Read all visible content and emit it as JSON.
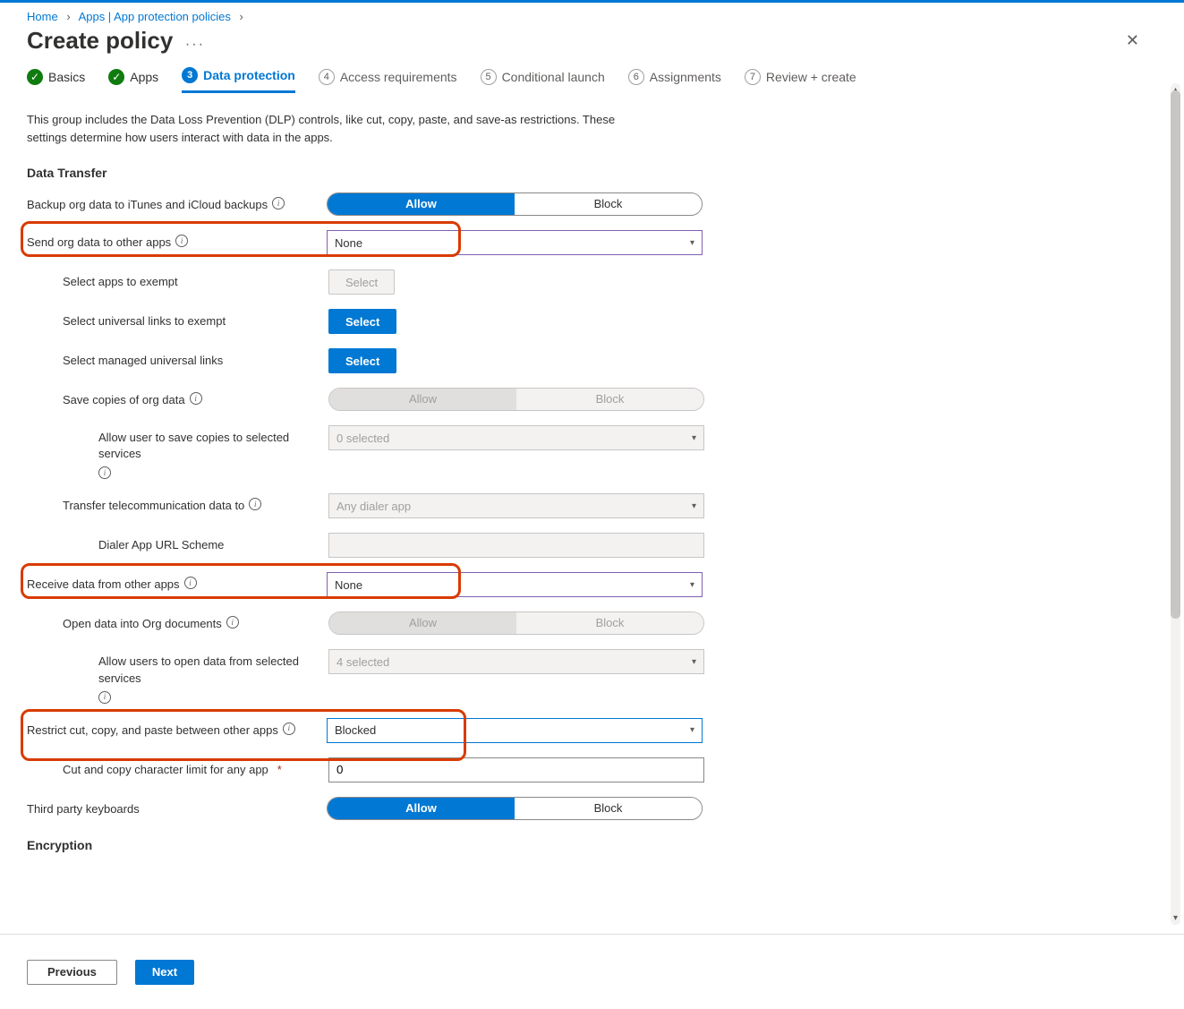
{
  "breadcrumb": {
    "home": "Home",
    "apps": "Apps | App protection policies"
  },
  "title": "Create policy",
  "steps": [
    {
      "num": "1",
      "label": "Basics",
      "state": "done"
    },
    {
      "num": "2",
      "label": "Apps",
      "state": "done"
    },
    {
      "num": "3",
      "label": "Data protection",
      "state": "current"
    },
    {
      "num": "4",
      "label": "Access requirements",
      "state": "future"
    },
    {
      "num": "5",
      "label": "Conditional launch",
      "state": "future"
    },
    {
      "num": "6",
      "label": "Assignments",
      "state": "future"
    },
    {
      "num": "7",
      "label": "Review + create",
      "state": "future"
    }
  ],
  "description": "This group includes the Data Loss Prevention (DLP) controls, like cut, copy, paste, and save-as restrictions. These settings determine how users interact with data in the apps.",
  "section_data_transfer": "Data Transfer",
  "section_encryption": "Encryption",
  "labels": {
    "backup": "Backup org data to iTunes and iCloud backups",
    "send": "Send org data to other apps",
    "exempt_apps": "Select apps to exempt",
    "exempt_links": "Select universal links to exempt",
    "managed_links": "Select managed universal links",
    "save_copies": "Save copies of org data",
    "save_services": "Allow user to save copies to selected services",
    "telecom": "Transfer telecommunication data to",
    "dialer": "Dialer App URL Scheme",
    "receive": "Receive data from other apps",
    "open_data": "Open data into Org documents",
    "open_services": "Allow users to open data from selected services",
    "restrict": "Restrict cut, copy, and paste between other apps",
    "char_limit": "Cut and copy character limit for any app",
    "keyboards": "Third party keyboards"
  },
  "values": {
    "send": "None",
    "save_services": "0 selected",
    "telecom": "Any dialer app",
    "receive": "None",
    "open_services": "4 selected",
    "restrict": "Blocked",
    "char_limit": "0"
  },
  "buttons": {
    "allow": "Allow",
    "block": "Block",
    "select": "Select",
    "previous": "Previous",
    "next": "Next"
  }
}
